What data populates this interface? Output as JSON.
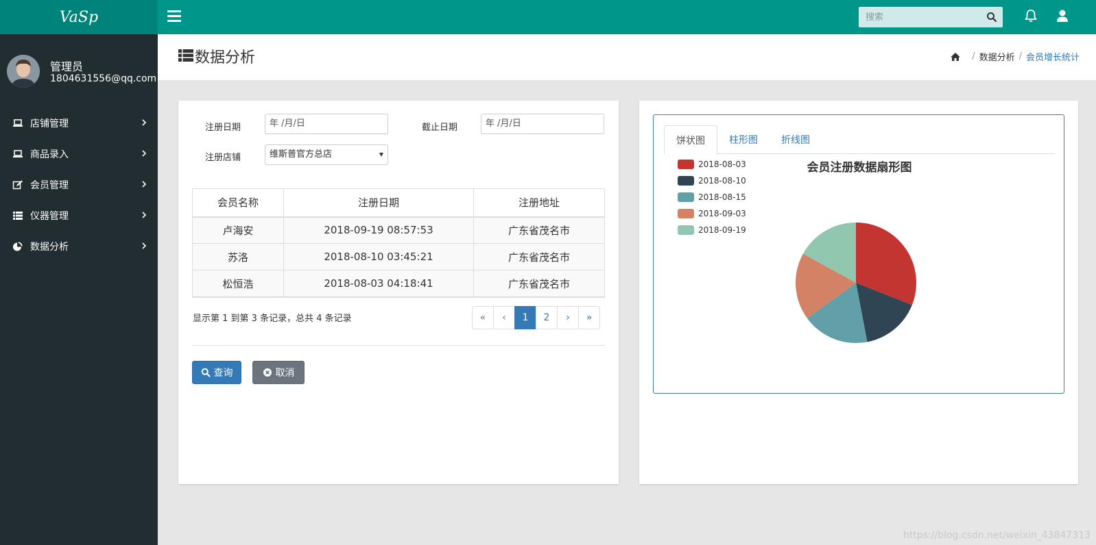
{
  "logo": "VaSp",
  "search": {
    "placeholder": "搜索"
  },
  "profile": {
    "name": "管理员",
    "email": "1804631556@qq.com"
  },
  "sidebar": {
    "items": [
      {
        "label": "店铺管理",
        "icon": "laptop-icon"
      },
      {
        "label": "商品录入",
        "icon": "laptop-icon"
      },
      {
        "label": "会员管理",
        "icon": "edit-icon"
      },
      {
        "label": "仪器管理",
        "icon": "list-icon"
      },
      {
        "label": "数据分析",
        "icon": "pie-chart-icon"
      }
    ]
  },
  "header": {
    "title": "数据分析",
    "breadcrumb": [
      "数据分析",
      "会员增长统计"
    ]
  },
  "form": {
    "reg_date_label": "注册日期",
    "reg_date_value": "年 /月/日",
    "end_date_label": "截止日期",
    "end_date_value": "年 /月/日",
    "store_label": "注册店铺",
    "store_value": "维斯普官方总店"
  },
  "table": {
    "headers": [
      "会员名称",
      "注册日期",
      "注册地址"
    ],
    "rows": [
      [
        "卢海安",
        "2018-09-19 08:57:53",
        "广东省茂名市"
      ],
      [
        "苏洛",
        "2018-08-10 03:45:21",
        "广东省茂名市"
      ],
      [
        "松恒浩",
        "2018-08-03 04:18:41",
        "广东省茂名市"
      ]
    ]
  },
  "pagination": {
    "info": "显示第 1 到第 3 条记录，总共 4 条记录",
    "first": "«",
    "prev": "‹",
    "pages": [
      "1",
      "2"
    ],
    "current": "1",
    "next": "›",
    "last": "»"
  },
  "buttons": {
    "query": "查询",
    "cancel": "取消"
  },
  "tabs": [
    "饼状图",
    "柱形图",
    "折线图"
  ],
  "chart_data": {
    "type": "pie",
    "title": "会员注册数据扇形图",
    "labels": [
      "2018-08-03",
      "2018-08-10",
      "2018-08-15",
      "2018-09-03",
      "2018-09-19"
    ],
    "values": [
      31,
      16,
      18,
      18,
      17
    ],
    "colors": [
      "#c23531",
      "#2f4554",
      "#61a0a8",
      "#d48265",
      "#91c7ae"
    ],
    "legend_position": "top-left"
  },
  "watermark": "https://blog.csdn.net/weixin_43847313"
}
